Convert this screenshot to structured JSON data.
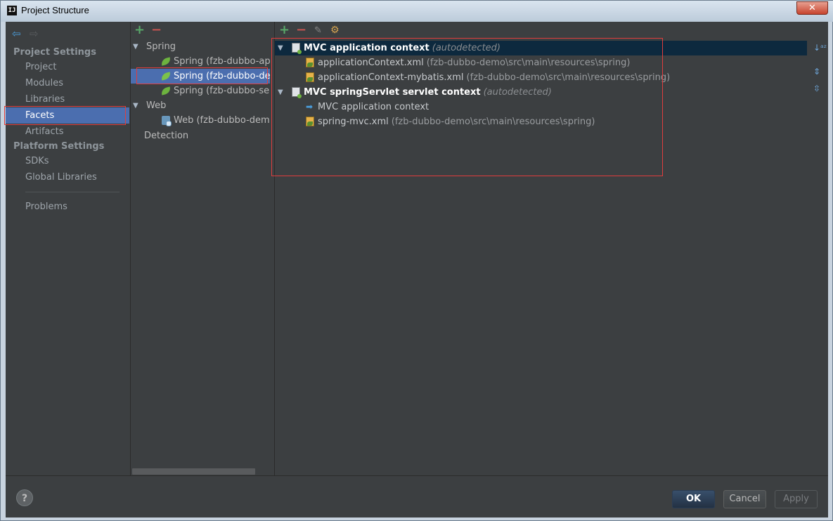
{
  "window": {
    "title": "Project Structure",
    "close_label": "✕"
  },
  "sidebar": {
    "project_settings_header": "Project Settings",
    "project_items": [
      "Project",
      "Modules",
      "Libraries",
      "Facets",
      "Artifacts"
    ],
    "selected": "Facets",
    "platform_settings_header": "Platform Settings",
    "platform_items": [
      "SDKs",
      "Global Libraries"
    ],
    "problems": "Problems"
  },
  "facets_tree": {
    "spring_group": "Spring",
    "spring_items": [
      "Spring (fzb-dubbo-api)",
      "Spring (fzb-dubbo-demo)",
      "Spring (fzb-dubbo-service)"
    ],
    "selected": "Spring (fzb-dubbo-demo)",
    "web_group": "Web",
    "web_items": [
      "Web (fzb-dubbo-demo)"
    ],
    "detection": "Detection"
  },
  "contexts": [
    {
      "title": "MVC application context",
      "tag": "(autodetected)",
      "files": [
        {
          "name": "applicationContext.xml",
          "path": "(fzb-dubbo-demo\\src\\main\\resources\\spring)"
        },
        {
          "name": "applicationContext-mybatis.xml",
          "path": "(fzb-dubbo-demo\\src\\main\\resources\\spring)"
        }
      ]
    },
    {
      "title": "MVC springServlet servlet context",
      "tag": "(autodetected)",
      "parent": "MVC application context",
      "files": [
        {
          "name": "spring-mvc.xml",
          "path": "(fzb-dubbo-demo\\src\\main\\resources\\spring)"
        }
      ]
    }
  ],
  "toolbar": {
    "add": "+",
    "remove": "−"
  },
  "buttons": {
    "ok": "OK",
    "cancel": "Cancel",
    "apply": "Apply",
    "help": "?"
  },
  "colors": {
    "accent": "#4b6eaf",
    "highlight_row": "#0d293e",
    "annotation_red": "#e03d3d",
    "add_green": "#59a869",
    "remove_red": "#c75450"
  }
}
